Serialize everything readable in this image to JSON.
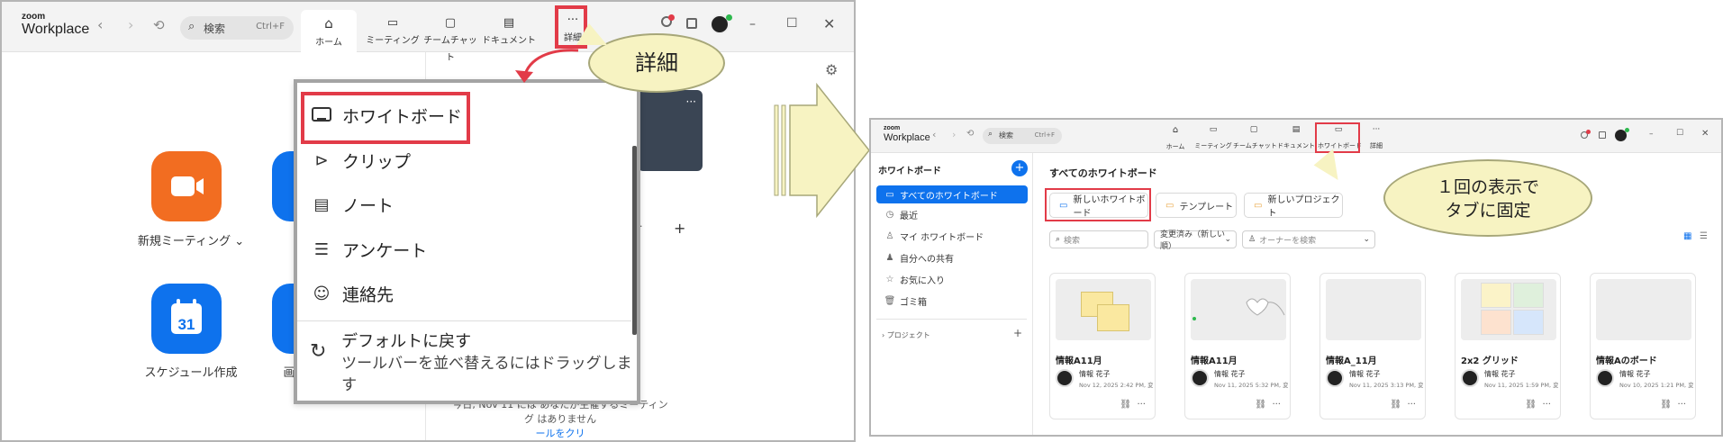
{
  "left": {
    "logo": {
      "zoom": "zoom",
      "product": "Workplace"
    },
    "search": {
      "placeholder": "検索",
      "shortcut": "Ctrl+F"
    },
    "tabs": [
      {
        "label": "ホーム",
        "icon": "home-icon",
        "active": true
      },
      {
        "label": "ミーティング",
        "icon": "video-icon",
        "active": false
      },
      {
        "label": "チームチャット",
        "icon": "chat-icon",
        "active": false
      },
      {
        "label": "ドキュメント",
        "icon": "document-icon",
        "active": false
      },
      {
        "label": "詳細",
        "icon": "more-icon",
        "active": false
      }
    ],
    "apps": [
      {
        "label": "新規ミーティング",
        "icon": "video-camera-icon",
        "color": "#f26d21"
      },
      {
        "label": "スケジュール作成",
        "icon": "calendar-icon",
        "color": "#0e72ed",
        "day": "31"
      }
    ],
    "partial_caption": "画",
    "menu": {
      "items": [
        {
          "label": "ホワイトボード",
          "icon": "whiteboard-icon"
        },
        {
          "label": "クリップ",
          "icon": "clip-icon"
        },
        {
          "label": "ノート",
          "icon": "note-icon"
        },
        {
          "label": "アンケート",
          "icon": "survey-icon"
        },
        {
          "label": "連絡先",
          "icon": "contact-icon"
        }
      ],
      "reset_label": "デフォルトに戻す",
      "reset_hint": "ツールバーを並べ替えるにはドラッグします"
    },
    "bg_text_1": "今日, Nov 11 には あなたが主催するミーティン",
    "bg_text_2": "グ はありません",
    "bg_text_3": "ールをクリ",
    "callout": "詳細"
  },
  "right": {
    "logo": {
      "zoom": "zoom",
      "product": "Workplace"
    },
    "search": {
      "placeholder": "検索",
      "shortcut": "Ctrl+F"
    },
    "tabs": [
      {
        "label": "ホーム",
        "icon": "home-icon"
      },
      {
        "label": "ミーティング",
        "icon": "video-icon"
      },
      {
        "label": "チームチャット",
        "icon": "chat-icon"
      },
      {
        "label": "ドキュメント",
        "icon": "document-icon"
      },
      {
        "label": "ホワイトボード",
        "icon": "whiteboard-icon"
      },
      {
        "label": "詳細",
        "icon": "more-icon"
      }
    ],
    "sidebar": {
      "title": "ホワイトボード",
      "items": [
        {
          "label": "すべてのホワイトボード",
          "icon": "board-icon",
          "selected": true
        },
        {
          "label": "最近",
          "icon": "clock-icon",
          "selected": false
        },
        {
          "label": "マイ ホワイトボード",
          "icon": "person-icon",
          "selected": false
        },
        {
          "label": "自分への共有",
          "icon": "people-icon",
          "selected": false
        },
        {
          "label": "お気に入り",
          "icon": "star-icon",
          "selected": false
        },
        {
          "label": "ゴミ箱",
          "icon": "trash-icon",
          "selected": false
        }
      ],
      "projects": "プロジェクト"
    },
    "heading": "すべてのホワイトボード",
    "actions": {
      "new_board": "新しいホワイトボード",
      "template": "テンプレート",
      "new_project": "新しいプロジェクト"
    },
    "filters": {
      "search_placeholder": "検索",
      "sort": "変更済み（新しい順）",
      "owner_placeholder": "オーナーを検索"
    },
    "boards": [
      {
        "name": "情報A11月",
        "owner": "情報 花子",
        "date": "Nov 12, 2025 2:42 PM, 変更済..."
      },
      {
        "name": "情報A11月",
        "owner": "情報 花子",
        "date": "Nov 11, 2025 5:32 PM, 変更済..."
      },
      {
        "name": "情報A_11月",
        "owner": "情報 花子",
        "date": "Nov 11, 2025 3:13 PM, 変更済..."
      },
      {
        "name": "2x2 グリッド",
        "owner": "情報 花子",
        "date": "Nov 11, 2025 1:59 PM, 変更済..."
      },
      {
        "name": "情報Aのボード",
        "owner": "情報 花子",
        "date": "Nov 10, 2025 1:21 PM, 変更済..."
      }
    ],
    "callout_line1": "１回の表示で",
    "callout_line2": "タブに固定"
  },
  "colors": {
    "accent": "#0e72ed",
    "highlight": "#e23b48",
    "callout": "#f7f3c2",
    "orange": "#f26d21"
  }
}
